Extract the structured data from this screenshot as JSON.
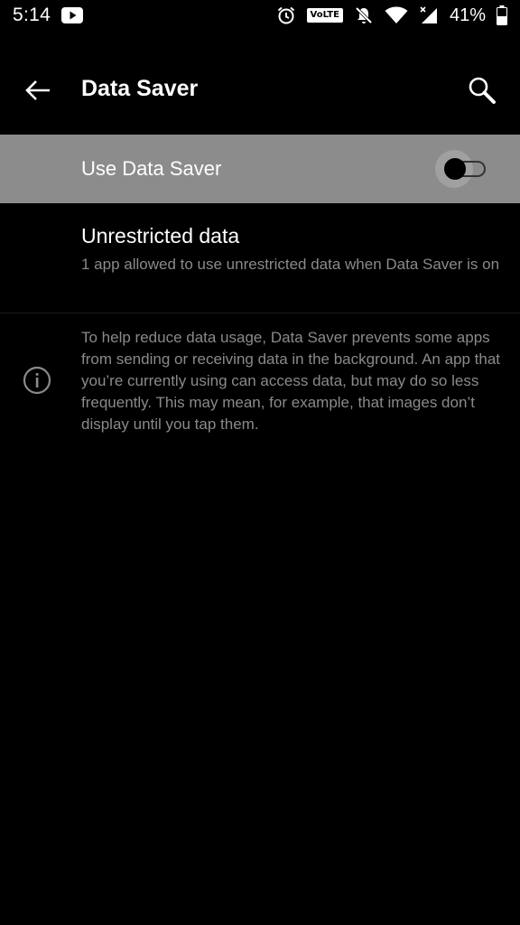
{
  "status_bar": {
    "time": "5:14",
    "volte": "VoLTE",
    "battery_percent": "41%",
    "icons": [
      "youtube-icon",
      "alarm-icon",
      "volte-badge",
      "notifications-off-icon",
      "wifi-icon",
      "cell-signal-icon",
      "battery-icon"
    ]
  },
  "app_bar": {
    "title": "Data Saver",
    "back_icon": "arrow-back-icon",
    "search_icon": "search-icon"
  },
  "data_saver_toggle": {
    "label": "Use Data Saver",
    "enabled": false
  },
  "unrestricted": {
    "title": "Unrestricted data",
    "summary": "1 app allowed to use unrestricted data when Data Saver is on"
  },
  "footer": {
    "info_text": "To help reduce data usage, Data Saver prevents some apps from sending or receiving data in the background. An app that you’re currently using can access data, but may do so less frequently. This may mean, for example, that images don’t display until you tap them."
  },
  "colors": {
    "background": "#000000",
    "highlight_row": "#8c8c8c",
    "secondary_text": "#8a8a8a"
  }
}
